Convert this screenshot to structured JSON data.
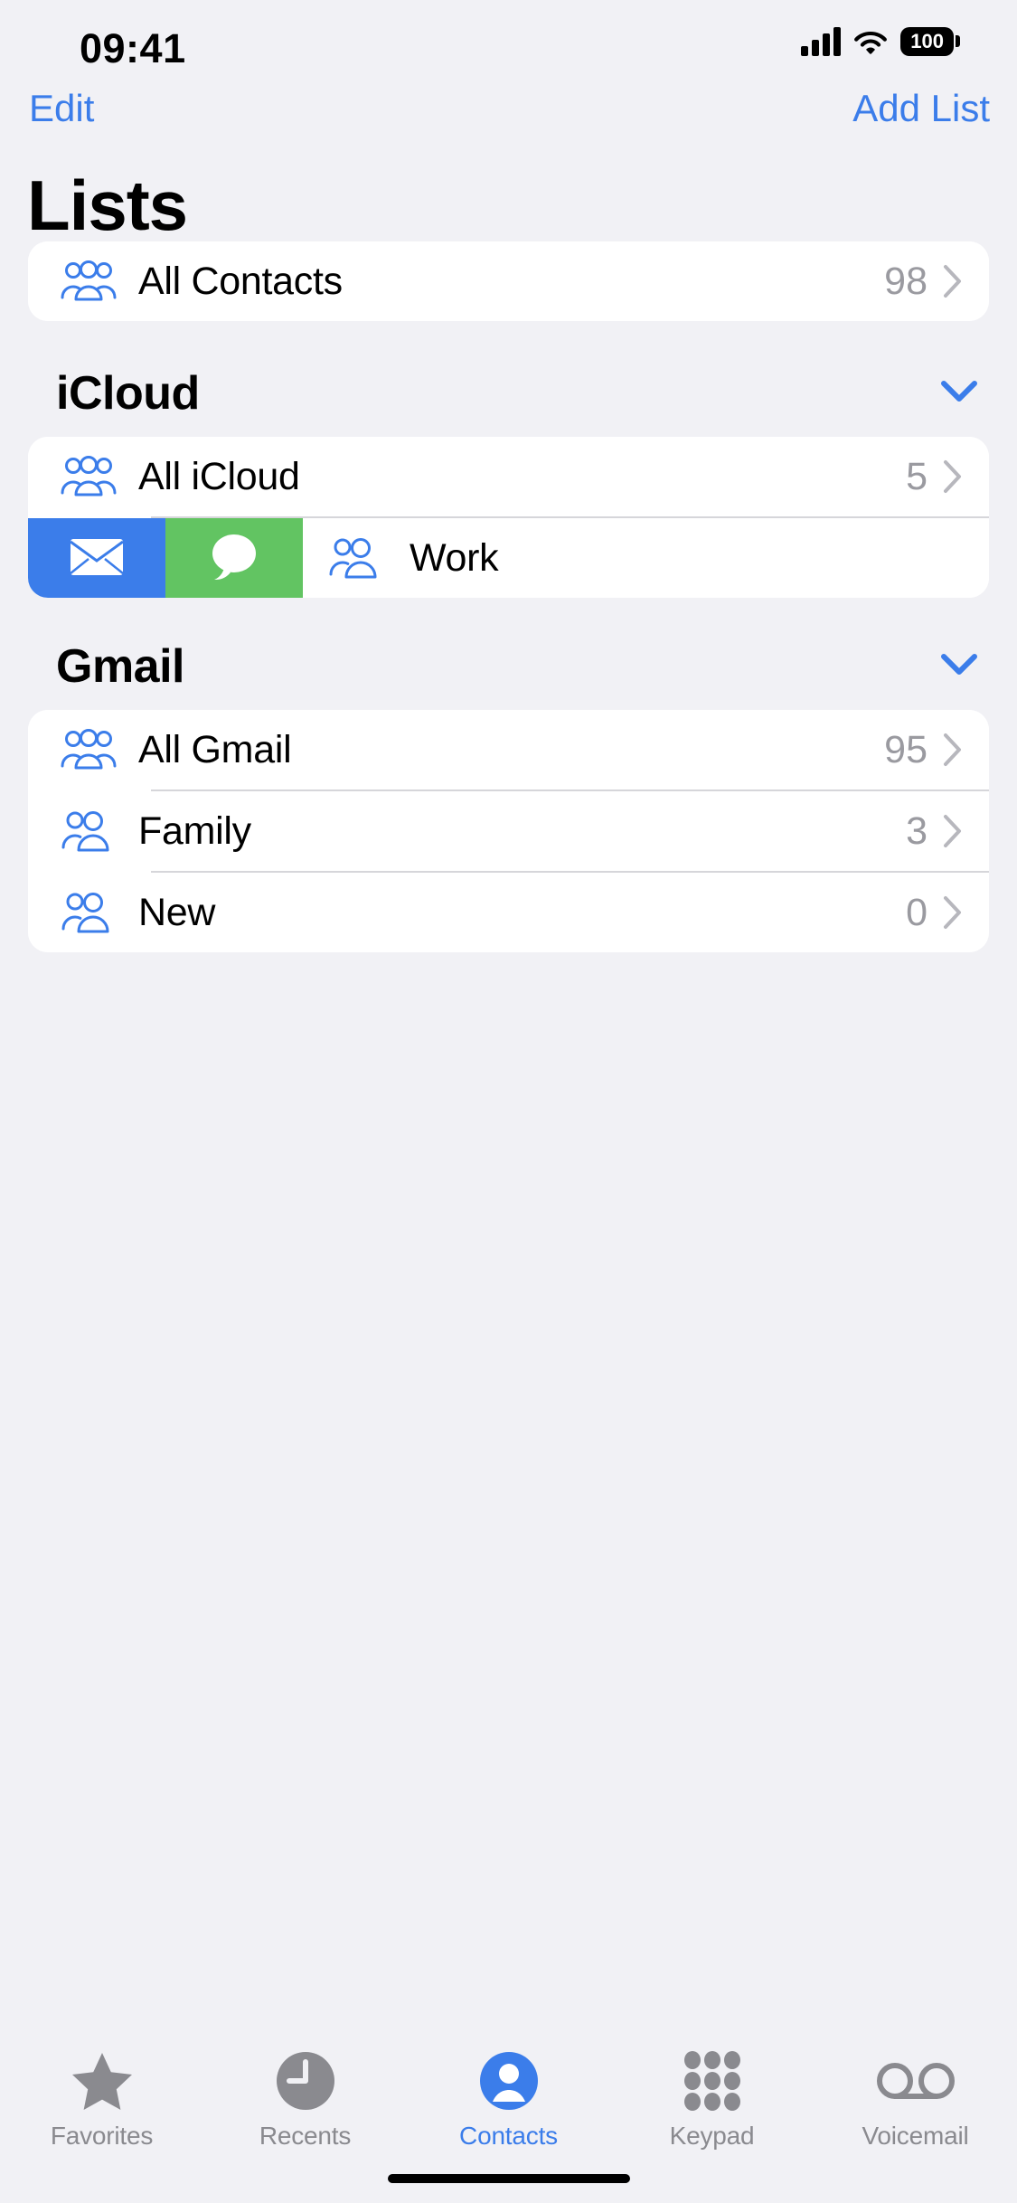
{
  "status_bar": {
    "time": "09:41",
    "battery_level": "100",
    "signal_icon": "cellular-bars-icon",
    "wifi_icon": "wifi-icon",
    "battery_icon": "battery-icon"
  },
  "nav_bar": {
    "edit_label": "Edit",
    "add_list_label": "Add List"
  },
  "page_title": "Lists",
  "all_contacts": {
    "label": "All Contacts",
    "count": "98",
    "icon": "three-people-icon",
    "chevron": "chevron-right-icon"
  },
  "sections": [
    {
      "title": "iCloud",
      "collapse_icon": "chevron-down-icon",
      "rows": [
        {
          "label": "All iCloud",
          "count": "5",
          "icon": "three-people-icon",
          "chevron": "chevron-right-icon",
          "swiped": false
        },
        {
          "label": "Work",
          "count": "",
          "icon": "two-people-icon",
          "chevron": "",
          "swiped": true,
          "swipe_actions": [
            {
              "name": "mail-action",
              "icon": "envelope-icon",
              "color": "#3B7DEA"
            },
            {
              "name": "message-action",
              "icon": "speech-bubble-icon",
              "color": "#62C462"
            }
          ]
        }
      ]
    },
    {
      "title": "Gmail",
      "collapse_icon": "chevron-down-icon",
      "rows": [
        {
          "label": "All Gmail",
          "count": "95",
          "icon": "three-people-icon",
          "chevron": "chevron-right-icon",
          "swiped": false
        },
        {
          "label": "Family",
          "count": "3",
          "icon": "two-people-icon",
          "chevron": "chevron-right-icon",
          "swiped": false
        },
        {
          "label": "New",
          "count": "0",
          "icon": "two-people-icon",
          "chevron": "chevron-right-icon",
          "swiped": false
        }
      ]
    }
  ],
  "tab_bar": {
    "active": "Contacts",
    "tabs": [
      {
        "label": "Favorites",
        "icon": "star-icon"
      },
      {
        "label": "Recents",
        "icon": "clock-icon"
      },
      {
        "label": "Contacts",
        "icon": "person-circle-icon"
      },
      {
        "label": "Keypad",
        "icon": "keypad-dots-icon"
      },
      {
        "label": "Voicemail",
        "icon": "voicemail-icon"
      }
    ]
  },
  "colors": {
    "accent_blue": "#3B7DEA",
    "message_green": "#62C462",
    "background": "#F1F1F5",
    "card": "#FFFFFF",
    "secondary_text": "#9A9AA0",
    "tab_inactive": "#8A8A8F"
  }
}
